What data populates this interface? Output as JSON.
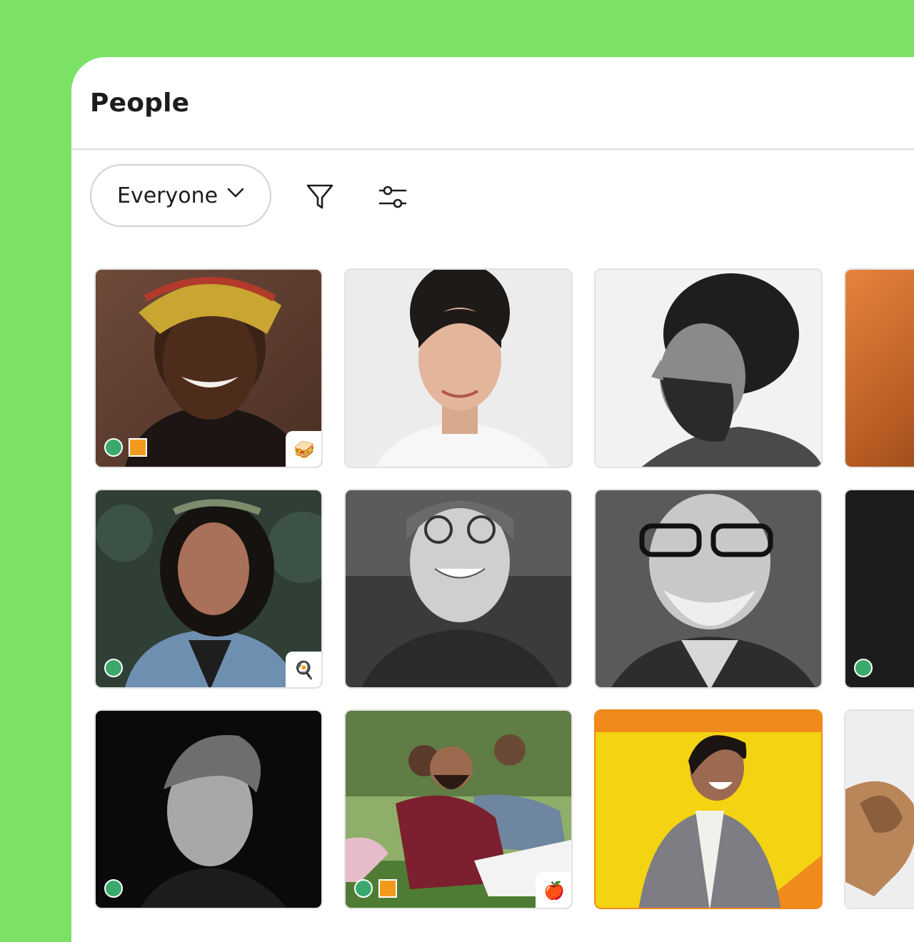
{
  "page": {
    "title": "People",
    "background_color": "#7be267"
  },
  "toolbar": {
    "audience_select": {
      "selected": "Everyone",
      "icon": "chevron-down-icon"
    },
    "filter_button": {
      "icon": "filter-icon"
    },
    "settings_button": {
      "icon": "sliders-icon"
    }
  },
  "people": [
    {
      "row": 1,
      "col": 1,
      "photo": "smiling woman with colorful headwrap",
      "online": true,
      "status_square": true,
      "emoji": "🥪"
    },
    {
      "row": 1,
      "col": 2,
      "photo": "woman with hair bun, light background",
      "online": false,
      "status_square": false,
      "emoji": ""
    },
    {
      "row": 1,
      "col": 3,
      "photo": "bearded man with curly hair, profile, black and white",
      "online": false,
      "status_square": false,
      "emoji": ""
    },
    {
      "row": 1,
      "col": 4,
      "photo": "orange blurred portrait (partially visible)",
      "online": false,
      "status_square": false,
      "emoji": ""
    },
    {
      "row": 2,
      "col": 1,
      "photo": "woman with long dark hair and flower crown, denim jacket",
      "online": true,
      "status_square": false,
      "emoji": "🍳"
    },
    {
      "row": 2,
      "col": 2,
      "photo": "smiling man with round glasses, black and white",
      "online": false,
      "status_square": false,
      "emoji": ""
    },
    {
      "row": 2,
      "col": 3,
      "photo": "bald man with beard and glasses, black and white",
      "online": false,
      "status_square": false,
      "emoji": ""
    },
    {
      "row": 2,
      "col": 4,
      "photo": "dark portrait (partially visible)",
      "online": true,
      "status_square": false,
      "emoji": ""
    },
    {
      "row": 3,
      "col": 1,
      "photo": "young man portrait, black background, black and white",
      "online": true,
      "status_square": false,
      "emoji": ""
    },
    {
      "row": 3,
      "col": 2,
      "photo": "group of friends sitting on grass",
      "online": true,
      "status_square": true,
      "emoji": "🍎"
    },
    {
      "row": 3,
      "col": 3,
      "photo": "laughing man in grey coat, yellow wall",
      "online": false,
      "status_square": false,
      "emoji": ""
    },
    {
      "row": 3,
      "col": 4,
      "photo": "dog close-up (partially visible)",
      "online": false,
      "status_square": false,
      "emoji": ""
    }
  ]
}
